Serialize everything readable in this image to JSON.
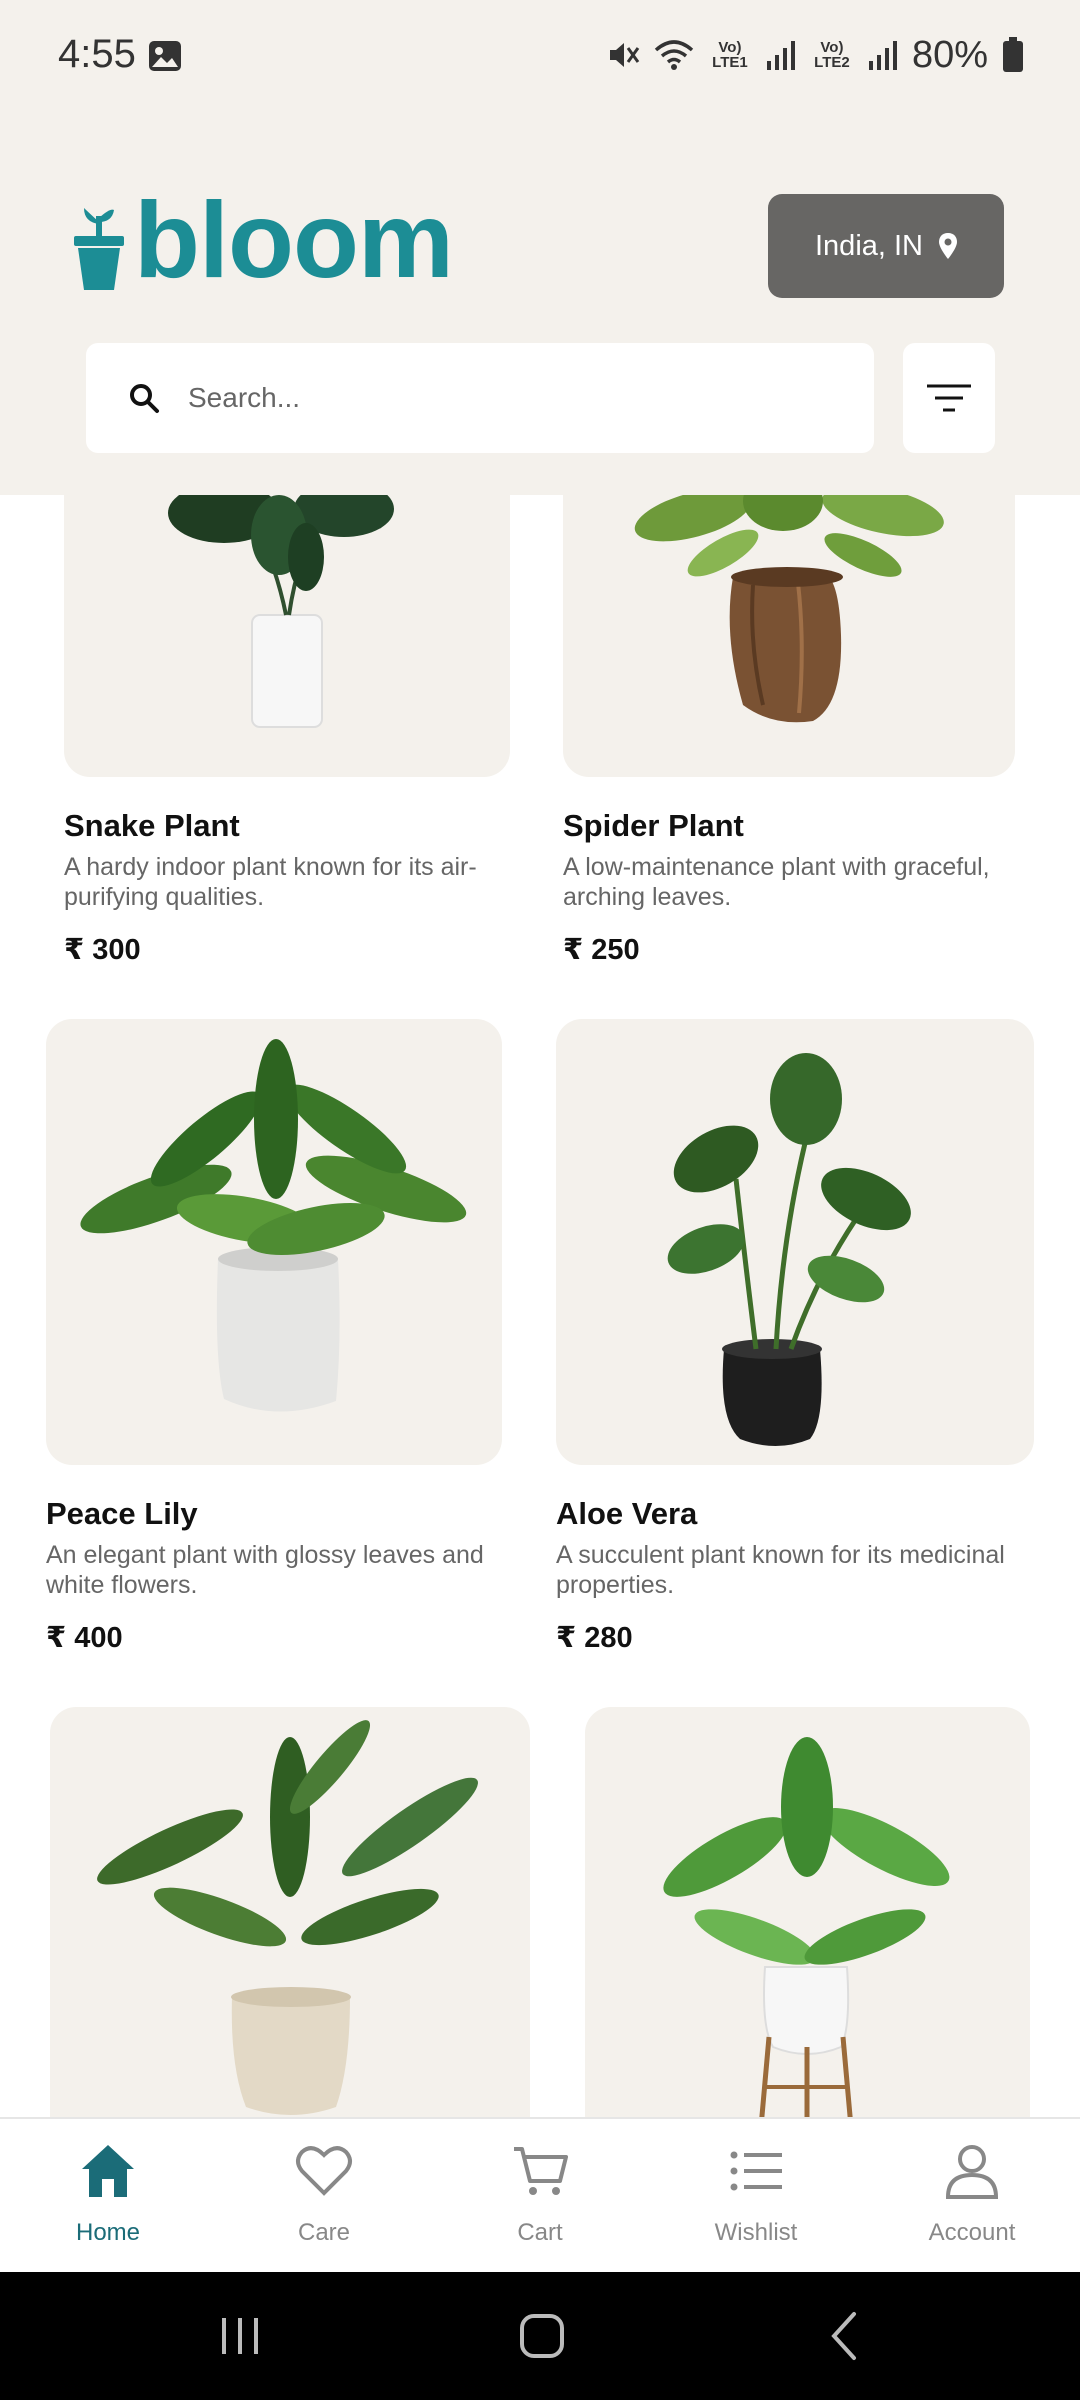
{
  "status_bar": {
    "time": "4:55",
    "battery": "80%",
    "sim1_label": "Vo) LTE1",
    "sim2_label": "Vo) LTE2"
  },
  "header": {
    "logo_text": "bloom",
    "location_label": "India, IN",
    "search_placeholder": "Search..."
  },
  "products": [
    {
      "name": "Snake Plant",
      "description": "A hardy indoor plant known for its air-purifying qualities.",
      "price": "₹ 300"
    },
    {
      "name": "Spider Plant",
      "description": "A low-maintenance plant with graceful, arching leaves.",
      "price": "₹ 250"
    },
    {
      "name": "Peace Lily",
      "description": "An elegant plant with glossy leaves and white flowers.",
      "price": "₹ 400"
    },
    {
      "name": "Aloe Vera",
      "description": "A succulent plant known for its medicinal properties.",
      "price": "₹ 280"
    },
    {
      "name": "",
      "description": "",
      "price": ""
    },
    {
      "name": "",
      "description": "",
      "price": ""
    }
  ],
  "bottom_nav": {
    "items": [
      {
        "label": "Home",
        "icon": "home-icon",
        "active": true
      },
      {
        "label": "Care",
        "icon": "heart-icon",
        "active": false
      },
      {
        "label": "Cart",
        "icon": "cart-icon",
        "active": false
      },
      {
        "label": "Wishlist",
        "icon": "list-icon",
        "active": false
      },
      {
        "label": "Account",
        "icon": "user-icon",
        "active": false
      }
    ]
  },
  "colors": {
    "brand": "#1c8d95",
    "nav_active": "#1b6c78",
    "background": "#f4f1ec",
    "location_button": "#676664"
  }
}
